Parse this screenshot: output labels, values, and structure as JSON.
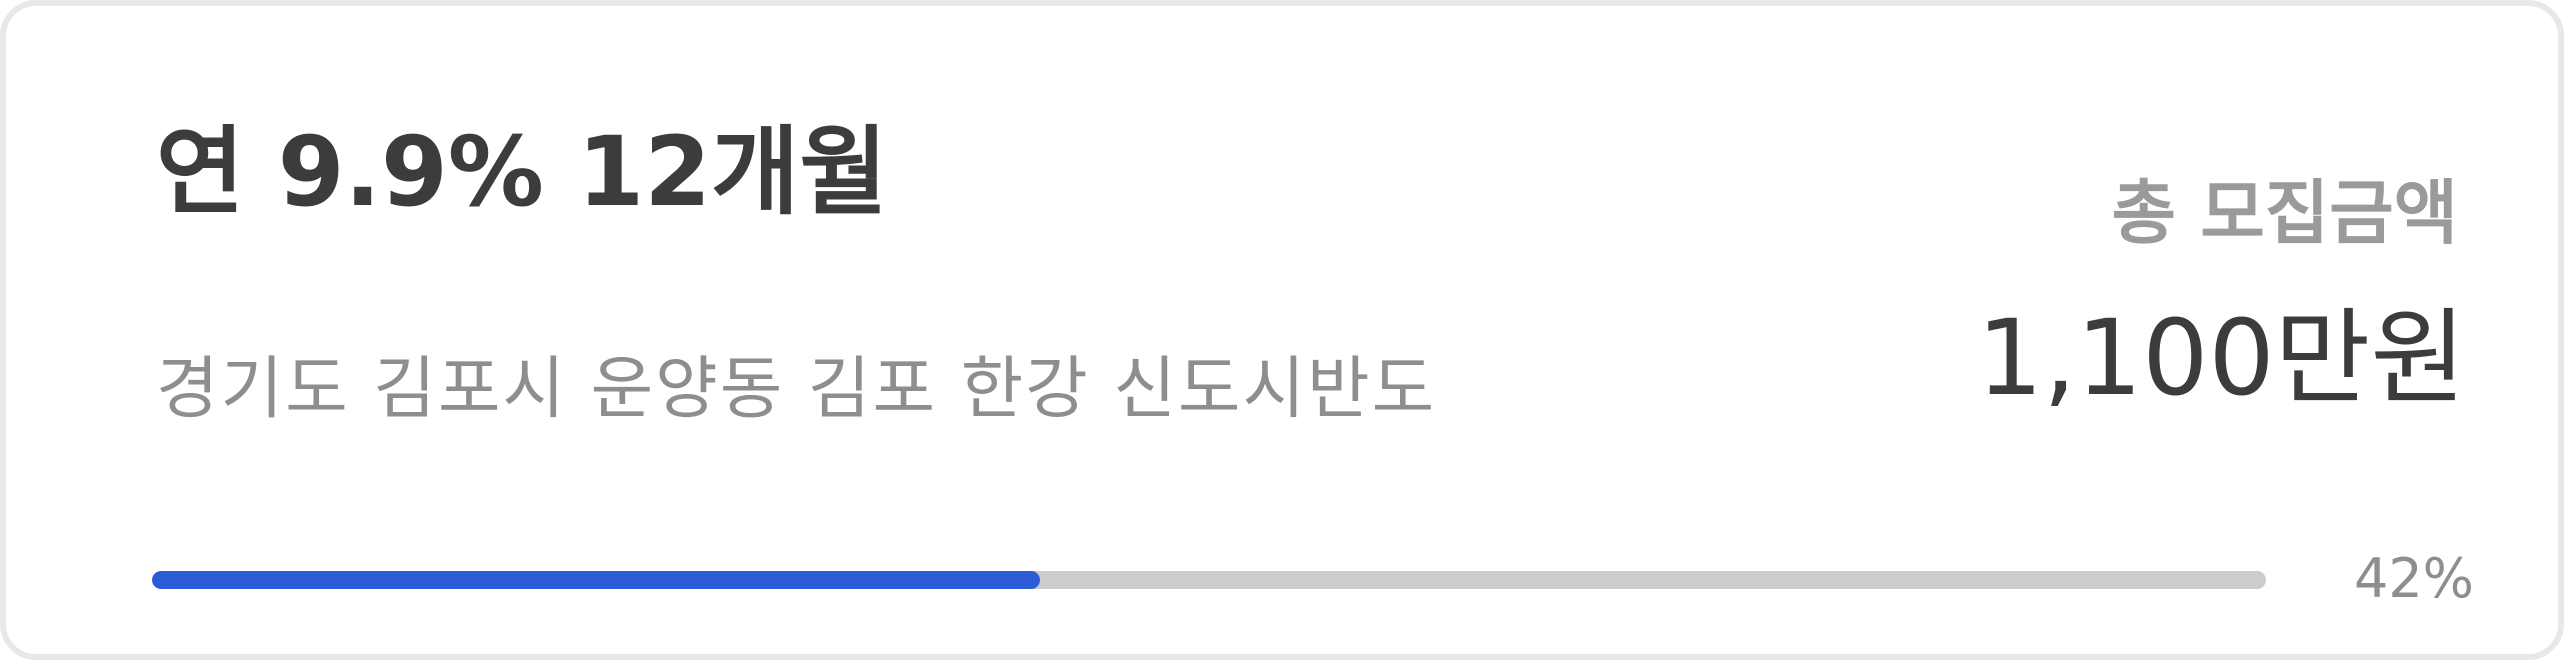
{
  "card": {
    "title": "연 9.9% 12개월",
    "address": "경기도 김포시 운양동 김포 한강 신도시반도",
    "total": {
      "label": "총 모집금액",
      "value": "1,100만원"
    },
    "progress": {
      "percent": 42,
      "label": "42%",
      "fill_color": "#2c5bd6",
      "track_color": "#cccccc"
    }
  }
}
